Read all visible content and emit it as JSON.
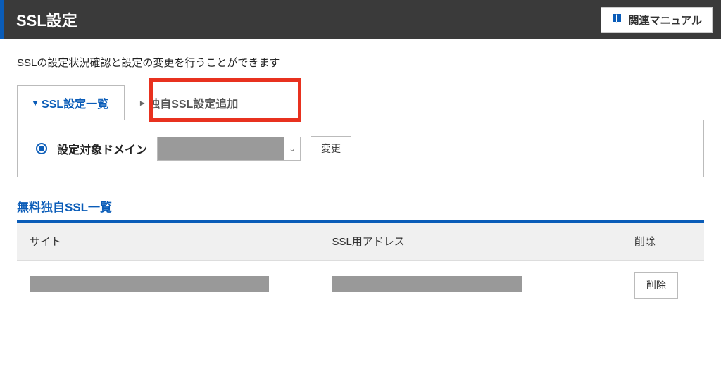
{
  "header": {
    "title": "SSL設定",
    "manual_button": "関連マニュアル"
  },
  "description": "SSLの設定状況確認と設定の変更を行うことができます",
  "tabs": {
    "list": "SSL設定一覧",
    "add": "独自SSL設定追加"
  },
  "domain_panel": {
    "label": "設定対象ドメイン",
    "change_button": "変更"
  },
  "section_title": "無料独自SSL一覧",
  "table": {
    "headers": {
      "site": "サイト",
      "address": "SSL用アドレス",
      "delete": "削除"
    },
    "row": {
      "delete_button": "削除"
    }
  }
}
